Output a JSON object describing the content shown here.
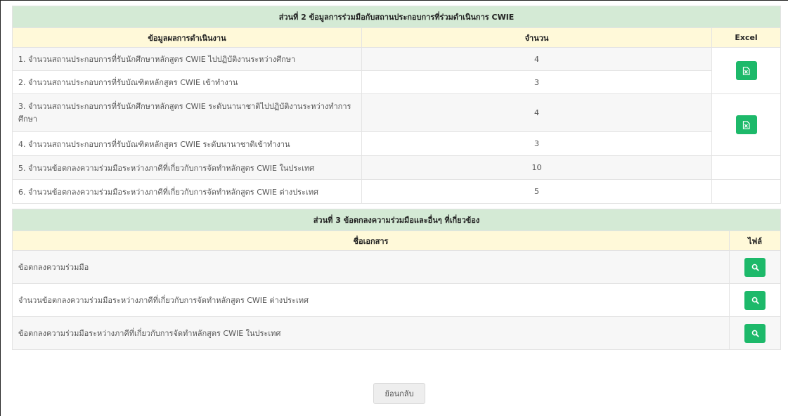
{
  "section2": {
    "title": "ส่วนที่ 2 ข้อมูลการร่วมมือกับสถานประกอบการที่ร่วมดำเนินการ CWIE",
    "col_result": "ข้อมูลผลการดำเนินงาน",
    "col_amount": "จำนวน",
    "col_excel": "Excel",
    "rows": [
      {
        "label": "1. จำนวนสถานประกอบการที่รับนักศึกษาหลักสูตร CWIE ไปปฏิบัติงานระหว่างศึกษา",
        "value": "4"
      },
      {
        "label": "2. จำนวนสถานประกอบการที่รับบัณฑิตหลักสูตร CWIE เข้าทำงาน",
        "value": "3"
      },
      {
        "label": "3. จำนวนสถานประกอบการที่รับนักศึกษาหลักสูตร CWIE ระดับนานาชาติไปปฏิบัติงานระหว่างทำการศึกษา",
        "value": "4"
      },
      {
        "label": "4. จำนวนสถานประกอบการที่รับบัณฑิตหลักสูตร CWIE ระดับนานาชาติเข้าทำงาน",
        "value": "3"
      },
      {
        "label": "5. จำนวนข้อตกลงความร่วมมือระหว่างภาคีที่เกี่ยวกับการจัดทำหลักสูตร CWIE ในประเทศ",
        "value": "10"
      },
      {
        "label": "6. จำนวนข้อตกลงความร่วมมือระหว่างภาคีที่เกี่ยวกับการจัดทำหลักสูตร CWIE ต่างประเทศ",
        "value": "5"
      }
    ]
  },
  "section3": {
    "title": "ส่วนที่ 3 ข้อตกลงความร่วมมือและอื่นๆ ที่เกี่ยวข้อง",
    "col_doc": "ชื่อเอกสาร",
    "col_file": "ไฟล์",
    "docs": [
      {
        "label": "ข้อตกลงความร่วมมือ"
      },
      {
        "label": "จำนวนข้อตกลงความร่วมมือระหว่างภาคีที่เกี่ยวกับการจัดทำหลักสูตร CWIE ต่างประเทศ"
      },
      {
        "label": "ข้อตกลงความร่วมมือระหว่างภาคีที่เกี่ยวกับการจัดทำหลักสูตร CWIE ในประเทศ"
      }
    ]
  },
  "back_label": "ย้อนกลับ",
  "icons": {
    "excel": "excel-file-icon",
    "view": "search-icon"
  },
  "colors": {
    "section_header": "#d4ead5",
    "column_header": "#fff9d9",
    "button": "#1db96a"
  }
}
